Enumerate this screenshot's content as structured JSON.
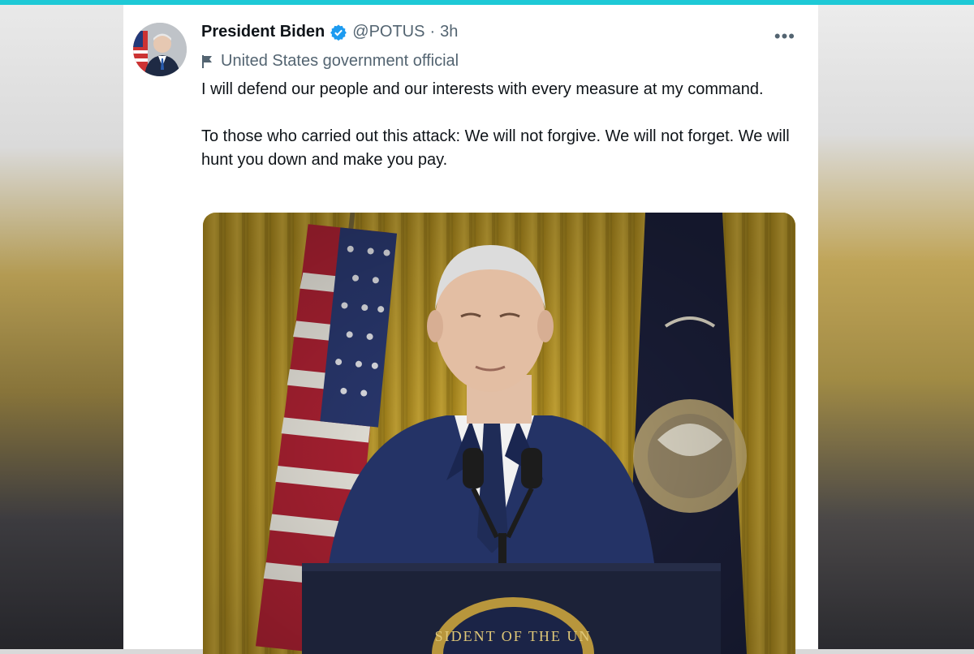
{
  "tweet": {
    "display_name": "President Biden",
    "handle": "@POTUS",
    "separator": "·",
    "time": "3h",
    "more_label": "•••",
    "account_label": "United States government official",
    "paragraphs": [
      "I will defend our people and our interests with every measure at my command.",
      "To those who carried out this attack: We will not forgive. We will not forget. We will hunt you down and make you pay."
    ],
    "media": {
      "seal_text": "SIDENT OF THE UN"
    }
  },
  "colors": {
    "accent_top_rule": "#1ec9d6",
    "verified_badge": "#1d9bf0",
    "secondary_text": "#536471",
    "primary_text": "#0f1419"
  },
  "icons": {
    "verified": "verified-badge-icon",
    "label": "flag-icon",
    "more": "more-options-icon"
  }
}
